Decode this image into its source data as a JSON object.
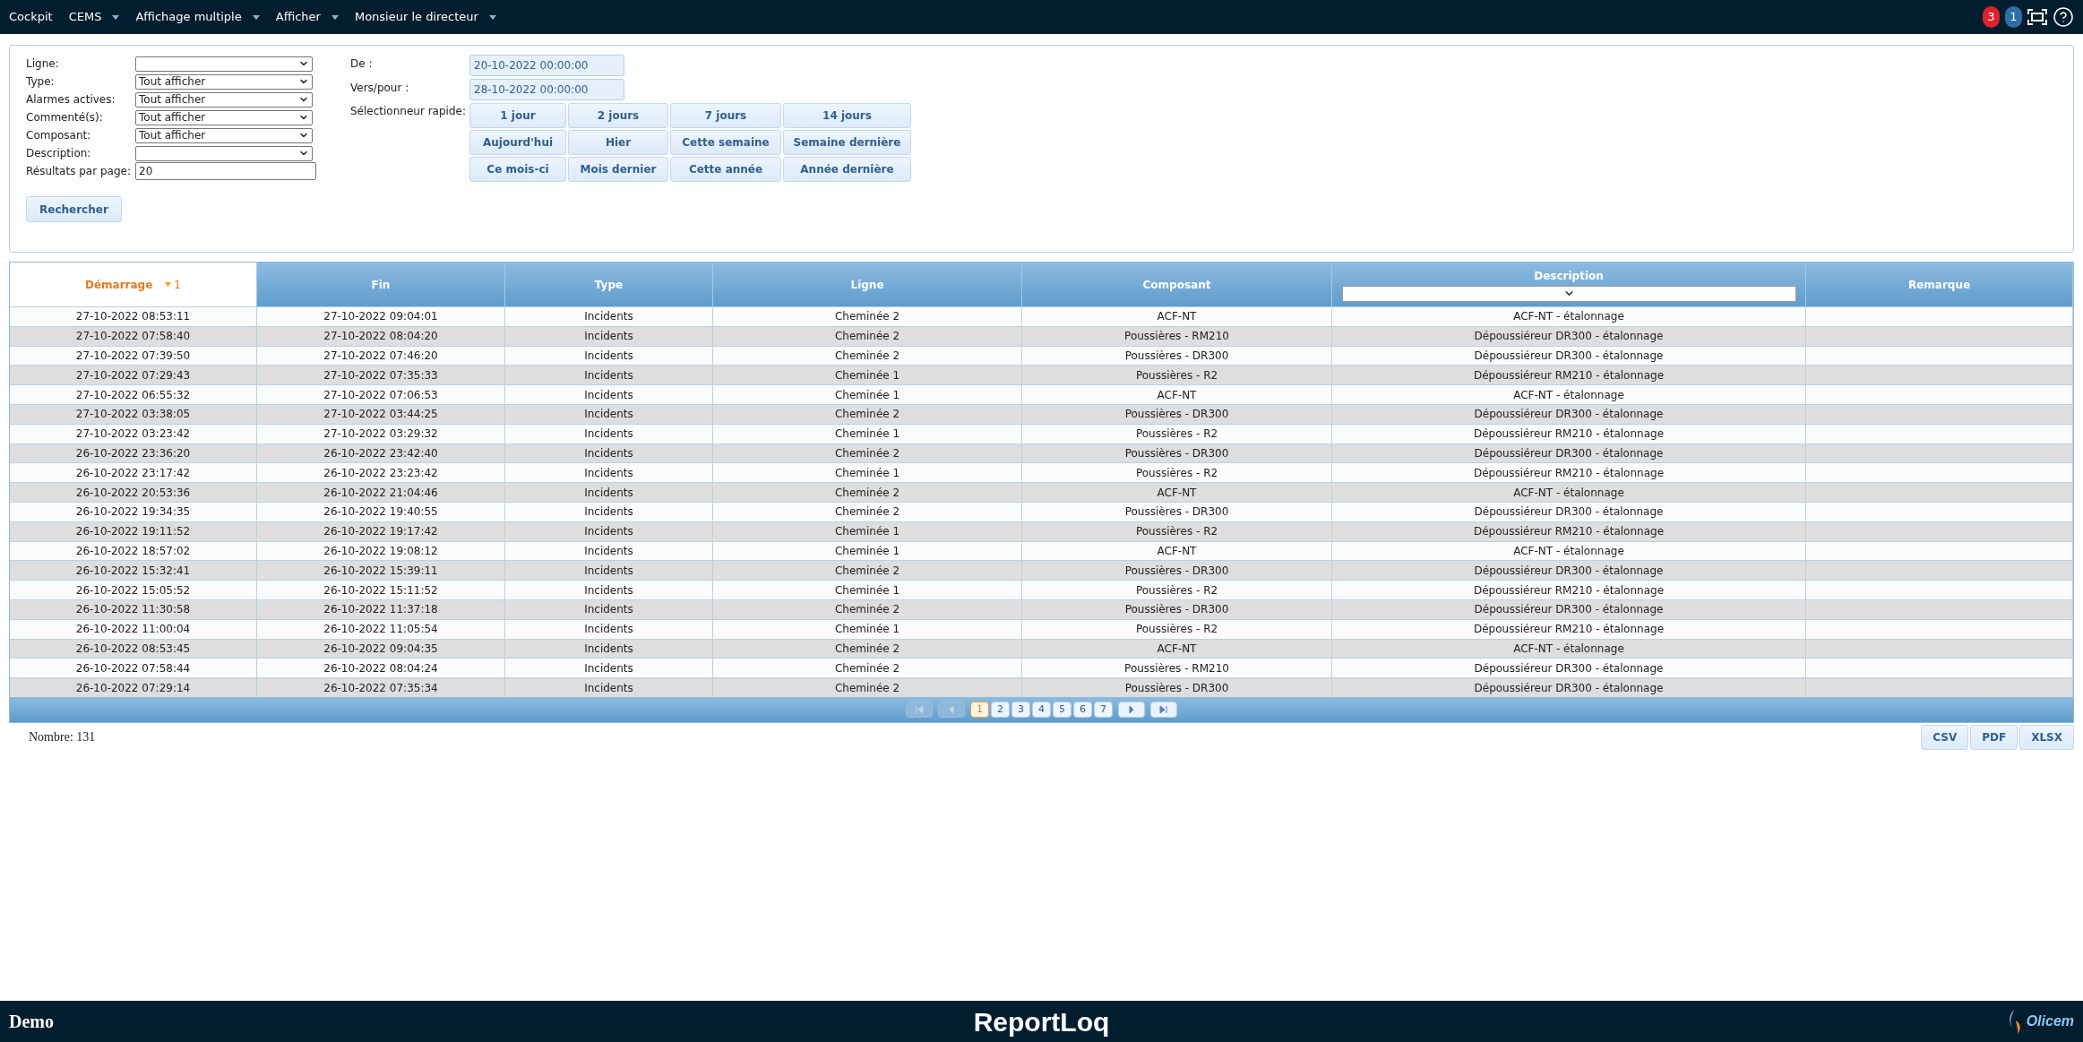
{
  "nav": [
    {
      "label": "Cockpit",
      "dropdown": false
    },
    {
      "label": "CEMS",
      "dropdown": true
    },
    {
      "label": "Affichage multiple",
      "dropdown": true
    },
    {
      "label": "Afficher",
      "dropdown": true
    },
    {
      "label": "Monsieur le directeur",
      "dropdown": true
    }
  ],
  "badges": [
    {
      "text": "3",
      "color": "#d9232d"
    },
    {
      "text": "1",
      "color": "#2f6ea8"
    }
  ],
  "filters": [
    {
      "label": "Ligne:",
      "kind": "select"
    },
    {
      "label": "Type:",
      "kind": "select",
      "value": "Tout afficher"
    },
    {
      "label": "Alarmes actives:",
      "kind": "select",
      "value": "Tout afficher"
    },
    {
      "label": "Commenté(s):",
      "kind": "select",
      "value": "Tout afficher"
    },
    {
      "label": "Composant:",
      "kind": "select",
      "value": "Tout afficher"
    },
    {
      "label": "Description:",
      "kind": "select"
    },
    {
      "label": "Résultats par page:",
      "kind": "input",
      "value": "20"
    }
  ],
  "dates": [
    {
      "label": "De :",
      "value": "20-10-2022 00:00:00"
    },
    {
      "label": "Vers/pour :",
      "value": "28-10-2022 00:00:00"
    }
  ],
  "quick_label": "Sélectionneur rapide:",
  "quick_buttons": [
    "1 jour",
    "2 jours",
    "7 jours",
    "14 jours",
    "Aujourd'hui",
    "Hier",
    "Cette semaine",
    "Semaine dernière",
    "Ce mois-ci",
    "Mois dernier",
    "Cette année",
    "Année dernière"
  ],
  "search_button": "Rechercher",
  "table": {
    "columns": [
      {
        "label": "Démarrage",
        "sorted": true,
        "sort_rank": "1",
        "filter": false
      },
      {
        "label": "Fin",
        "sorted": false,
        "filter": false
      },
      {
        "label": "Type",
        "sorted": false,
        "filter": false
      },
      {
        "label": "Ligne",
        "sorted": false,
        "filter": false
      },
      {
        "label": "Composant",
        "sorted": false,
        "filter": false
      },
      {
        "label": "Description",
        "sorted": false,
        "filter": true
      },
      {
        "label": "Remarque",
        "sorted": false,
        "filter": false
      }
    ],
    "rows": [
      [
        "27-10-2022 08:53:11",
        "27-10-2022 09:04:01",
        "Incidents",
        "Cheminée 2",
        "ACF-NT",
        "ACF-NT - étalonnage"
      ],
      [
        "27-10-2022 07:58:40",
        "27-10-2022 08:04:20",
        "Incidents",
        "Cheminée 2",
        "Poussières - RM210",
        "Dépoussiéreur DR300 - étalonnage"
      ],
      [
        "27-10-2022 07:39:50",
        "27-10-2022 07:46:20",
        "Incidents",
        "Cheminée 2",
        "Poussières - DR300",
        "Dépoussiéreur DR300 - étalonnage"
      ],
      [
        "27-10-2022 07:29:43",
        "27-10-2022 07:35:33",
        "Incidents",
        "Cheminée 1",
        "Poussières - R2",
        "Dépoussiéreur RM210 - étalonnage"
      ],
      [
        "27-10-2022 06:55:32",
        "27-10-2022 07:06:53",
        "Incidents",
        "Cheminée 1",
        "ACF-NT",
        "ACF-NT - étalonnage"
      ],
      [
        "27-10-2022 03:38:05",
        "27-10-2022 03:44:25",
        "Incidents",
        "Cheminée 2",
        "Poussières - DR300",
        "Dépoussiéreur DR300 - étalonnage"
      ],
      [
        "27-10-2022 03:23:42",
        "27-10-2022 03:29:32",
        "Incidents",
        "Cheminée 1",
        "Poussières - R2",
        "Dépoussiéreur RM210 - étalonnage"
      ],
      [
        "26-10-2022 23:36:20",
        "26-10-2022 23:42:40",
        "Incidents",
        "Cheminée 2",
        "Poussières - DR300",
        "Dépoussiéreur DR300 - étalonnage"
      ],
      [
        "26-10-2022 23:17:42",
        "26-10-2022 23:23:42",
        "Incidents",
        "Cheminée 1",
        "Poussières - R2",
        "Dépoussiéreur RM210 - étalonnage"
      ],
      [
        "26-10-2022 20:53:36",
        "26-10-2022 21:04:46",
        "Incidents",
        "Cheminée 2",
        "ACF-NT",
        "ACF-NT - étalonnage"
      ],
      [
        "26-10-2022 19:34:35",
        "26-10-2022 19:40:55",
        "Incidents",
        "Cheminée 2",
        "Poussières - DR300",
        "Dépoussiéreur DR300 - étalonnage"
      ],
      [
        "26-10-2022 19:11:52",
        "26-10-2022 19:17:42",
        "Incidents",
        "Cheminée 1",
        "Poussières - R2",
        "Dépoussiéreur RM210 - étalonnage"
      ],
      [
        "26-10-2022 18:57:02",
        "26-10-2022 19:08:12",
        "Incidents",
        "Cheminée 1",
        "ACF-NT",
        "ACF-NT - étalonnage"
      ],
      [
        "26-10-2022 15:32:41",
        "26-10-2022 15:39:11",
        "Incidents",
        "Cheminée 2",
        "Poussières - DR300",
        "Dépoussiéreur DR300 - étalonnage"
      ],
      [
        "26-10-2022 15:05:52",
        "26-10-2022 15:11:52",
        "Incidents",
        "Cheminée 1",
        "Poussières - R2",
        "Dépoussiéreur RM210 - étalonnage"
      ],
      [
        "26-10-2022 11:30:58",
        "26-10-2022 11:37:18",
        "Incidents",
        "Cheminée 2",
        "Poussières - DR300",
        "Dépoussiéreur DR300 - étalonnage"
      ],
      [
        "26-10-2022 11:00:04",
        "26-10-2022 11:05:54",
        "Incidents",
        "Cheminée 1",
        "Poussières - R2",
        "Dépoussiéreur RM210 - étalonnage"
      ],
      [
        "26-10-2022 08:53:45",
        "26-10-2022 09:04:35",
        "Incidents",
        "Cheminée 2",
        "ACF-NT",
        "ACF-NT - étalonnage"
      ],
      [
        "26-10-2022 07:58:44",
        "26-10-2022 08:04:24",
        "Incidents",
        "Cheminée 2",
        "Poussières - RM210",
        "Dépoussiéreur DR300 - étalonnage"
      ],
      [
        "26-10-2022 07:29:14",
        "26-10-2022 07:35:34",
        "Incidents",
        "Cheminée 2",
        "Poussières - DR300",
        "Dépoussiéreur DR300 - étalonnage"
      ]
    ]
  },
  "pagination": {
    "nav_before": [
      {
        "kind": "first",
        "disabled": true
      },
      {
        "kind": "prev",
        "disabled": true
      }
    ],
    "pages": [
      {
        "label": "1",
        "selected": true
      },
      {
        "label": "2",
        "selected": false
      },
      {
        "label": "3",
        "selected": false
      },
      {
        "label": "4",
        "selected": false
      },
      {
        "label": "5",
        "selected": false
      },
      {
        "label": "6",
        "selected": false
      },
      {
        "label": "7",
        "selected": false
      }
    ],
    "nav_after": [
      {
        "kind": "next",
        "disabled": false
      },
      {
        "kind": "last",
        "disabled": false
      }
    ]
  },
  "count": "Nombre: 131",
  "exports": [
    "CSV",
    "PDF",
    "XLSX"
  ],
  "footer": {
    "left": "Demo",
    "center": "ReportLoq",
    "brand": "Olicem"
  }
}
